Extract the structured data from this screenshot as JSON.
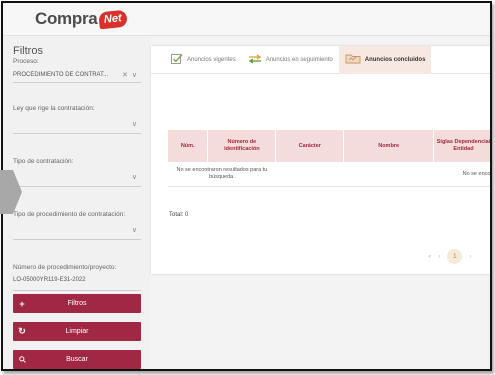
{
  "header": {
    "logo_text": "Compra",
    "logo_badge": "Net"
  },
  "sidebar": {
    "title": "Filtros",
    "proceso_label": "Proceso:",
    "proceso_value": "PROCEDIMIENTO DE CONTRAT...",
    "ley_label": "Ley que rige la contratación:",
    "tipo_label": "Tipo de contratación:",
    "tipo_proc_label": "Tipo de procedimiento de contratación:",
    "numero_label": "Número de procedimiento/proyecto:",
    "numero_value": "LO-05000YR119-E31-2022",
    "buttons": {
      "filtros": "Filtros",
      "limpiar": "Limpiar",
      "buscar": "Buscar"
    }
  },
  "tabs": [
    {
      "label": "Anuncios vigentes",
      "icon": "checkbox-icon"
    },
    {
      "label": "Anuncios en seguimiento",
      "icon": "swap-arrows-icon"
    },
    {
      "label": "Anuncios concluidos",
      "icon": "folder-icon"
    }
  ],
  "table": {
    "headers": {
      "num": "Núm.",
      "id": "Número de identificación",
      "caracter": "Carácter",
      "nombre": "Nombre",
      "siglas": "Siglas Dependencia/ Entidad"
    },
    "empty_message": "No se encontraron resultados para tu búsqueda.",
    "empty_message_right": "No se encon"
  },
  "total_label": "Total: 0",
  "pager": {
    "prev_first": "«",
    "prev": "‹",
    "current": "1",
    "next": "›"
  },
  "colors": {
    "accent": "#a02845",
    "header_row": "#f3dcd9",
    "active_tab": "#f7e8e1",
    "logo_badge": "#d9312b"
  }
}
